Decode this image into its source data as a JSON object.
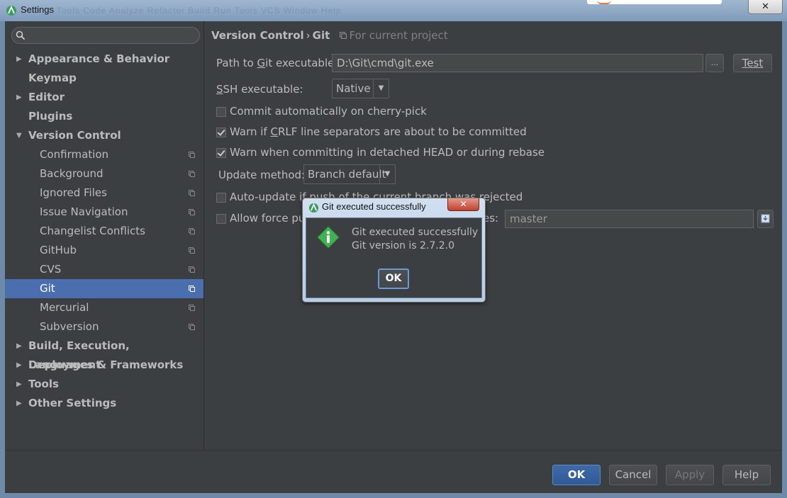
{
  "window": {
    "title": "Settings",
    "ghost_menu": "Tools  Code  Analyze  Refactor  Build  Run  Tools  VCS  Window  Help",
    "close_label": "✕"
  },
  "search": {
    "placeholder": ""
  },
  "sidebar": {
    "items": [
      {
        "label": "Appearance & Behavior",
        "arrow": "▶"
      },
      {
        "label": "Keymap"
      },
      {
        "label": "Editor",
        "arrow": "▶"
      },
      {
        "label": "Plugins"
      },
      {
        "label": "Version Control",
        "arrow": "▼"
      },
      {
        "label": "Confirmation"
      },
      {
        "label": "Background"
      },
      {
        "label": "Ignored Files"
      },
      {
        "label": "Issue Navigation"
      },
      {
        "label": "Changelist Conflicts"
      },
      {
        "label": "GitHub"
      },
      {
        "label": "CVS"
      },
      {
        "label": "Git"
      },
      {
        "label": "Mercurial"
      },
      {
        "label": "Subversion"
      },
      {
        "label": "Build, Execution, Deployment",
        "arrow": "▶"
      },
      {
        "label": "Languages & Frameworks",
        "arrow": "▶"
      },
      {
        "label": "Tools",
        "arrow": "▶"
      },
      {
        "label": "Other Settings",
        "arrow": "▶"
      }
    ]
  },
  "breadcrumb": {
    "section": "Version Control",
    "sep": "›",
    "page": "Git",
    "scope": "For current project"
  },
  "git": {
    "path_label_pre": "Path to ",
    "path_label_u": "G",
    "path_label_post": "it executable:",
    "path_value": "D:\\Git\\cmd\\git.exe",
    "browse_label": "...",
    "test_label": "Test",
    "ssh_label_u": "S",
    "ssh_label_post": "SH executable:",
    "ssh_value": "Native",
    "dropdown_glyph": "▼",
    "cherry_pick_label": "Commit automatically on cherry-pick",
    "crlf_label_pre": "Warn if ",
    "crlf_label_u": "C",
    "crlf_label_post": "RLF line separators are about to be committed",
    "detached_label": "Warn when committing in detached HEAD or during rebase",
    "update_method_label": "Update method:",
    "update_method_value": "Branch default",
    "auto_update_label": "Auto-update if push of the current branch was rejected",
    "force_push_label": "Allow force push",
    "protected_label_tail": "es:",
    "protected_value": "master"
  },
  "footer": {
    "ok": "OK",
    "cancel": "Cancel",
    "apply": "Apply",
    "help": "Help"
  },
  "dialog": {
    "title": "Git executed successfully",
    "close_label": "✕",
    "message_line1": "Git executed successfully",
    "message_line2": "Git version is 2.7.2.0",
    "ok": "OK"
  },
  "colors": {
    "selection": "#4b6eaf",
    "background": "#3c3f41",
    "dialog_icon": "#3fb34f"
  }
}
